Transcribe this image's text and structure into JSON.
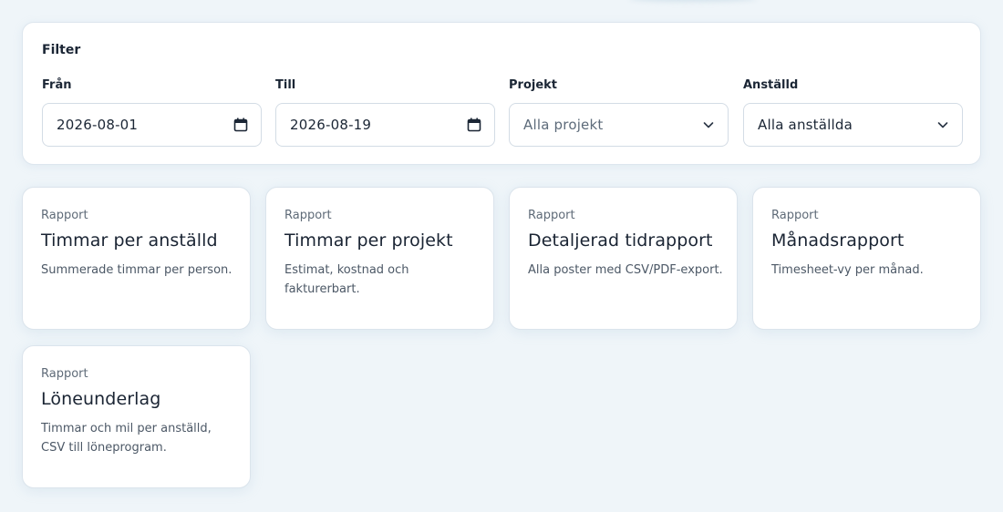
{
  "filter": {
    "title": "Filter",
    "from": {
      "label": "Från",
      "value": "2026-08-01"
    },
    "to": {
      "label": "Till",
      "value": "2026-08-19"
    },
    "project": {
      "label": "Projekt",
      "value": "Alla projekt"
    },
    "employee": {
      "label": "Anställd",
      "value": "Alla anställda"
    }
  },
  "reports": [
    {
      "kicker": "Rapport",
      "title": "Timmar per anställd",
      "description": "Summerade timmar per person."
    },
    {
      "kicker": "Rapport",
      "title": "Timmar per projekt",
      "description": "Estimat, kostnad och fakturerbart."
    },
    {
      "kicker": "Rapport",
      "title": "Detaljerad tidrapport",
      "description": "Alla poster med CSV/PDF-export."
    },
    {
      "kicker": "Rapport",
      "title": "Månadsrapport",
      "description": "Timesheet-vy per månad."
    },
    {
      "kicker": "Rapport",
      "title": "Löneunderlag",
      "description": "Timmar och mil per anställd, CSV till löneprogram."
    }
  ],
  "icons": {
    "date": "calendar-icon",
    "select": "chevron-down-icon"
  },
  "colors": {
    "background": "#eff5f9",
    "card": "#ffffff",
    "text": "#1a2433",
    "muted": "#5f6b78"
  }
}
